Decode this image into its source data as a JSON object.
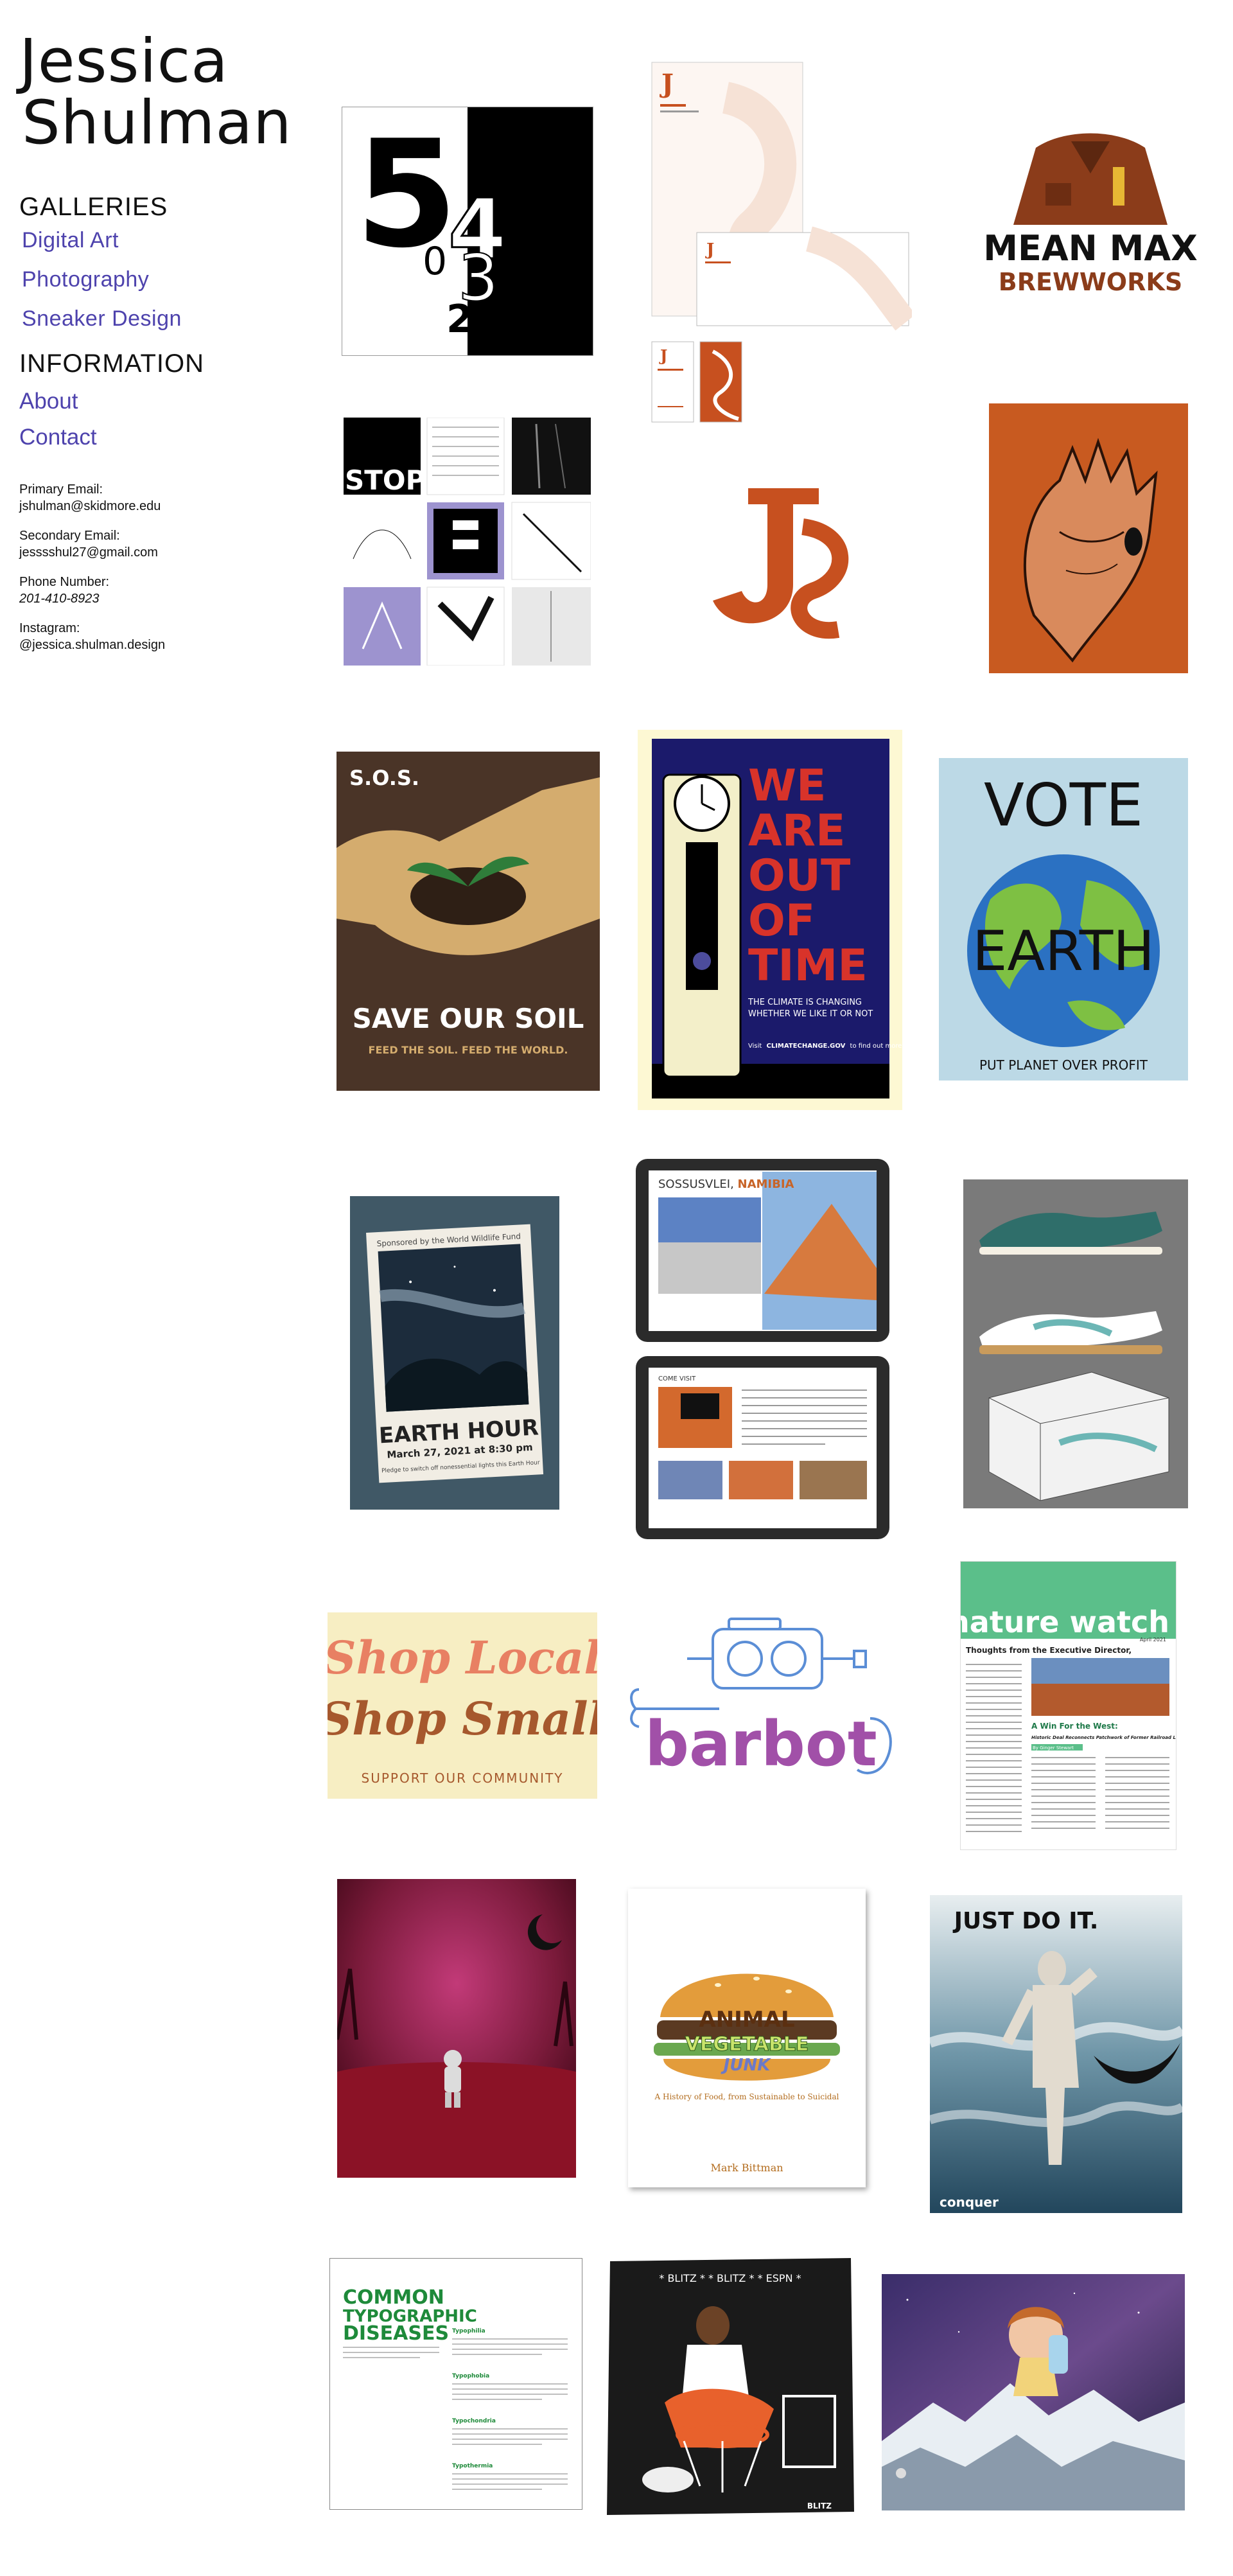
{
  "site": {
    "title_line1": "Jessica",
    "title_line2": "Shulman"
  },
  "galleries": {
    "heading": "GALLERIES",
    "links": [
      "Digital Art",
      "Photography",
      "Sneaker Design"
    ]
  },
  "information": {
    "heading": "INFORMATION",
    "links": [
      "About",
      "Contact"
    ],
    "primary_email_label": "Primary Email:",
    "primary_email": "jshulman@skidmore.edu",
    "secondary_email_label": "Secondary Email:",
    "secondary_email": "jesssshul27@gmail.com",
    "phone_label": "Phone Number:",
    "phone": "201-410-8923",
    "instagram_label": "Instagram:",
    "instagram": "@jessica.shulman.design"
  },
  "colors": {
    "link": "#4e43ad",
    "orange": "#c7501f",
    "brown": "#8b3c1a"
  },
  "artworks": {
    "numbers": {
      "big5": "5",
      "n4": "4",
      "n0": "0",
      "n3": "3",
      "n2": "2"
    },
    "stationery_logo": "J",
    "meanmax": {
      "line1": "MEAN MAX",
      "line2": "BREWWORKS"
    },
    "js_logo": "JS",
    "stop": "STOP",
    "sos": {
      "title": "S.O.S.",
      "headline": "SAVE OUR SOIL",
      "tagline": "FEED THE SOIL. FEED THE WORLD."
    },
    "time": {
      "l1": "WE",
      "l2": "ARE",
      "l3": "OUT",
      "l4": "OF",
      "l5": "TIME",
      "sub1": "THE CLIMATE IS CHANGING",
      "sub2": "WHETHER WE LIKE IT OR NOT",
      "visit": "Visit",
      "visit_url": "CLIMATECHANGE.GOV",
      "visit_end": "to find out more"
    },
    "vote": {
      "top": "VOTE",
      "mid": "EARTH",
      "bottom": "PUT PLANET OVER PROFIT"
    },
    "earthhour": {
      "sponsor": "Sponsored by the World Wildlife Fund",
      "title": "EARTH HOUR",
      "date": "March 27, 2021 at 8:30 pm",
      "note": "Pledge to switch off nonessential lights this Earth Hour"
    },
    "namibia": {
      "title_a": "SOSSUSVLEI, ",
      "title_b": "NAMIBIA",
      "page2": "COME VISIT"
    },
    "shop": {
      "l1": "Shop Local",
      "l2": "Shop Small",
      "l3": "SUPPORT OUR COMMUNITY"
    },
    "barbot": "barbot",
    "nature": {
      "masthead": "nature watch",
      "head1": "Thoughts from the Executive Director,",
      "head2": "A Win For the West:",
      "head3": "Historic Deal Reconnects Patchwork of Former Railroad Lands",
      "byline": "By Ginger Stewart",
      "issue": "April 2021"
    },
    "animal": {
      "l1": "ANIMAL",
      "l2": "VEGETABLE",
      "l3": "JUNK",
      "sub": "A History of Food, from Sustainable to Suicidal",
      "author": "Mark Bittman"
    },
    "justdoit": {
      "slogan": "JUST DO IT.",
      "corner": "conquer"
    },
    "typo": {
      "l1": "COMMON",
      "l2": "TYPOGRAPHIC",
      "l3": "DISEASES",
      "s1": "Typophilia",
      "s2": "Typophobia",
      "s3": "Typochondria",
      "s4": "Typothermia"
    },
    "blitz": {
      "band": "* BLITZ * * BLITZ * * ESPN *",
      "tag": "BLITZ"
    }
  }
}
